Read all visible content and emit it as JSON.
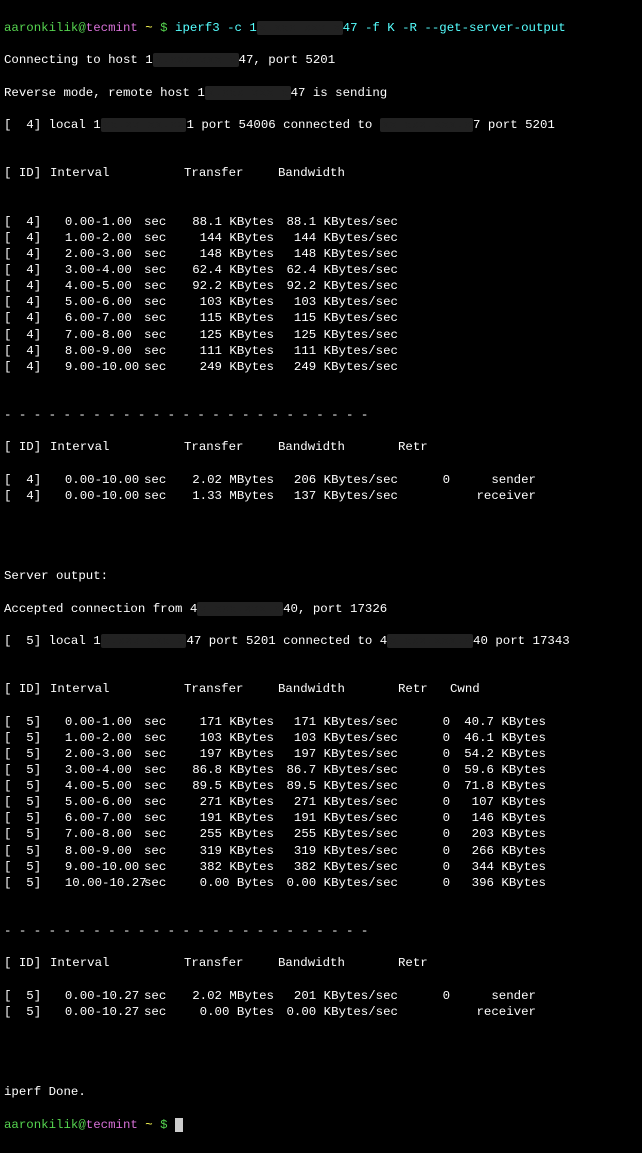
{
  "prompt": {
    "user": "aaronkilik",
    "host": "tecmint",
    "tilde": "~",
    "dollar": "$"
  },
  "cmd": "iperf3 -c 1x.xxx.xxx.x47 -f K -R --get-server-output",
  "cmd_pre": "iperf3 -c 1",
  "cmd_post": "47 -f K -R --get-server-output",
  "msg": {
    "connecting_pre": "Connecting to host 1",
    "connecting_post": "47, port 5201",
    "reverse_pre": "Reverse mode, remote host 1",
    "reverse_post": "47 is sending",
    "local4_pre": "[  4] local 1",
    "local4_mid": "1 port 54006 connected to ",
    "local4_post": "7 port 5201",
    "server_output": "Server output:",
    "accepted_pre": "Accepted connection from 4",
    "accepted_post": "40, port 17326",
    "local5_pre": "[  5] local 1",
    "local5_mid": "47 port 5201 connected to 4",
    "local5_post": "40 port 17343",
    "done": "iperf Done."
  },
  "hdr": {
    "id": "[ ID]",
    "interval": "Interval",
    "transfer": "Transfer",
    "bandwidth": "Bandwidth",
    "retr": "Retr",
    "cwnd": "Cwnd"
  },
  "dashes": "- - - - - - - - - - - - - - - - - - - - - - - - -",
  "clientRows": [
    {
      "id": "[  4]",
      "int": "0.00-1.00",
      "sec": "sec",
      "tr": "88.1 KBytes",
      "bw": "88.1 KBytes/sec"
    },
    {
      "id": "[  4]",
      "int": "1.00-2.00",
      "sec": "sec",
      "tr": "144 KBytes",
      "bw": "144 KBytes/sec"
    },
    {
      "id": "[  4]",
      "int": "2.00-3.00",
      "sec": "sec",
      "tr": "148 KBytes",
      "bw": "148 KBytes/sec"
    },
    {
      "id": "[  4]",
      "int": "3.00-4.00",
      "sec": "sec",
      "tr": "62.4 KBytes",
      "bw": "62.4 KBytes/sec"
    },
    {
      "id": "[  4]",
      "int": "4.00-5.00",
      "sec": "sec",
      "tr": "92.2 KBytes",
      "bw": "92.2 KBytes/sec"
    },
    {
      "id": "[  4]",
      "int": "5.00-6.00",
      "sec": "sec",
      "tr": "103 KBytes",
      "bw": "103 KBytes/sec"
    },
    {
      "id": "[  4]",
      "int": "6.00-7.00",
      "sec": "sec",
      "tr": "115 KBytes",
      "bw": "115 KBytes/sec"
    },
    {
      "id": "[  4]",
      "int": "7.00-8.00",
      "sec": "sec",
      "tr": "125 KBytes",
      "bw": "125 KBytes/sec"
    },
    {
      "id": "[  4]",
      "int": "8.00-9.00",
      "sec": "sec",
      "tr": "111 KBytes",
      "bw": "111 KBytes/sec"
    },
    {
      "id": "[  4]",
      "int": "9.00-10.00",
      "sec": "sec",
      "tr": "249 KBytes",
      "bw": "249 KBytes/sec"
    }
  ],
  "clientSummary": [
    {
      "id": "[  4]",
      "int": "0.00-10.00",
      "sec": "sec",
      "tr": "2.02 MBytes",
      "bw": "206 KBytes/sec",
      "retr": "0",
      "role": "sender"
    },
    {
      "id": "[  4]",
      "int": "0.00-10.00",
      "sec": "sec",
      "tr": "1.33 MBytes",
      "bw": "137 KBytes/sec",
      "retr": "",
      "role": "receiver"
    }
  ],
  "serverRows": [
    {
      "id": "[  5]",
      "int": "0.00-1.00",
      "sec": "sec",
      "tr": "171 KBytes",
      "bw": "171 KBytes/sec",
      "retr": "0",
      "cwnd": "40.7 KBytes"
    },
    {
      "id": "[  5]",
      "int": "1.00-2.00",
      "sec": "sec",
      "tr": "103 KBytes",
      "bw": "103 KBytes/sec",
      "retr": "0",
      "cwnd": "46.1 KBytes"
    },
    {
      "id": "[  5]",
      "int": "2.00-3.00",
      "sec": "sec",
      "tr": "197 KBytes",
      "bw": "197 KBytes/sec",
      "retr": "0",
      "cwnd": "54.2 KBytes"
    },
    {
      "id": "[  5]",
      "int": "3.00-4.00",
      "sec": "sec",
      "tr": "86.8 KBytes",
      "bw": "86.7 KBytes/sec",
      "retr": "0",
      "cwnd": "59.6 KBytes"
    },
    {
      "id": "[  5]",
      "int": "4.00-5.00",
      "sec": "sec",
      "tr": "89.5 KBytes",
      "bw": "89.5 KBytes/sec",
      "retr": "0",
      "cwnd": "71.8 KBytes"
    },
    {
      "id": "[  5]",
      "int": "5.00-6.00",
      "sec": "sec",
      "tr": "271 KBytes",
      "bw": "271 KBytes/sec",
      "retr": "0",
      "cwnd": "107 KBytes"
    },
    {
      "id": "[  5]",
      "int": "6.00-7.00",
      "sec": "sec",
      "tr": "191 KBytes",
      "bw": "191 KBytes/sec",
      "retr": "0",
      "cwnd": "146 KBytes"
    },
    {
      "id": "[  5]",
      "int": "7.00-8.00",
      "sec": "sec",
      "tr": "255 KBytes",
      "bw": "255 KBytes/sec",
      "retr": "0",
      "cwnd": "203 KBytes"
    },
    {
      "id": "[  5]",
      "int": "8.00-9.00",
      "sec": "sec",
      "tr": "319 KBytes",
      "bw": "319 KBytes/sec",
      "retr": "0",
      "cwnd": "266 KBytes"
    },
    {
      "id": "[  5]",
      "int": "9.00-10.00",
      "sec": "sec",
      "tr": "382 KBytes",
      "bw": "382 KBytes/sec",
      "retr": "0",
      "cwnd": "344 KBytes"
    },
    {
      "id": "[  5]",
      "int": "10.00-10.27",
      "sec": "sec",
      "tr": "0.00 Bytes",
      "bw": "0.00 KBytes/sec",
      "retr": "0",
      "cwnd": "396 KBytes"
    }
  ],
  "serverSummary": [
    {
      "id": "[  5]",
      "int": "0.00-10.27",
      "sec": "sec",
      "tr": "2.02 MBytes",
      "bw": "201 KBytes/sec",
      "retr": "0",
      "role": "sender"
    },
    {
      "id": "[  5]",
      "int": "0.00-10.27",
      "sec": "sec",
      "tr": "0.00 Bytes",
      "bw": "0.00 KBytes/sec",
      "retr": "",
      "role": "receiver"
    }
  ]
}
